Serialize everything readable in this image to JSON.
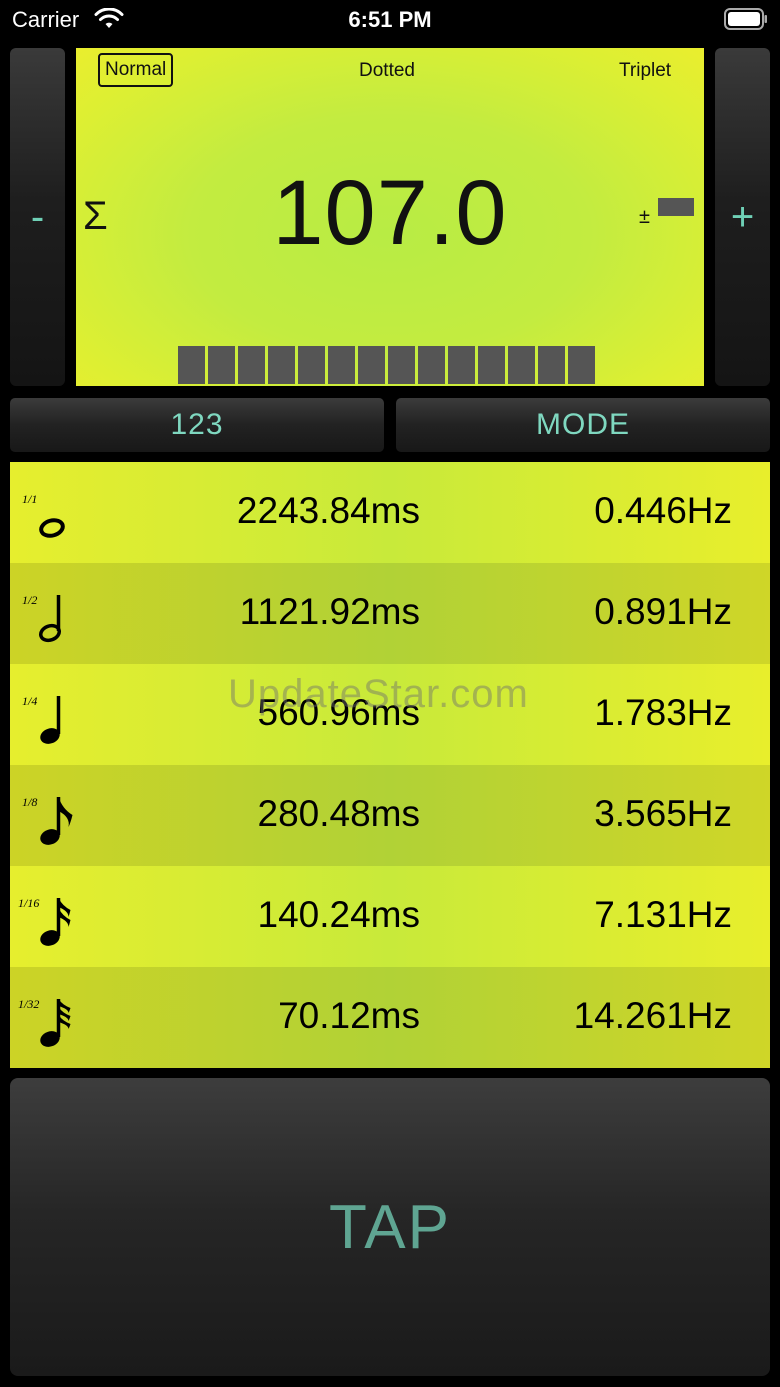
{
  "status_bar": {
    "carrier": "Carrier",
    "time": "6:51 PM"
  },
  "side_buttons": {
    "minus": "-",
    "plus": "+"
  },
  "display": {
    "modes": {
      "normal": "Normal",
      "dotted": "Dotted",
      "triplet": "Triplet"
    },
    "selected_mode": "Normal",
    "sigma": "Σ",
    "bpm": "107.0",
    "plus_minus": "±"
  },
  "buttons": {
    "numeric": "123",
    "mode": "MODE",
    "tap": "TAP"
  },
  "notes": [
    {
      "fraction": "1/1",
      "icon": "whole-note-icon",
      "ms": "2243.84ms",
      "hz": "0.446Hz"
    },
    {
      "fraction": "1/2",
      "icon": "half-note-icon",
      "ms": "1121.92ms",
      "hz": "0.891Hz"
    },
    {
      "fraction": "1/4",
      "icon": "quarter-note-icon",
      "ms": "560.96ms",
      "hz": "1.783Hz"
    },
    {
      "fraction": "1/8",
      "icon": "eighth-note-icon",
      "ms": "280.48ms",
      "hz": "3.565Hz"
    },
    {
      "fraction": "1/16",
      "icon": "sixteenth-note-icon",
      "ms": "140.24ms",
      "hz": "7.131Hz"
    },
    {
      "fraction": "1/32",
      "icon": "thirty-second-note-icon",
      "ms": "70.12ms",
      "hz": "14.261Hz"
    }
  ],
  "watermark": "UpdateStar.com",
  "colors": {
    "accent": "#6fd0b6",
    "lcd": "#c3ec40",
    "segment": "#555555"
  }
}
